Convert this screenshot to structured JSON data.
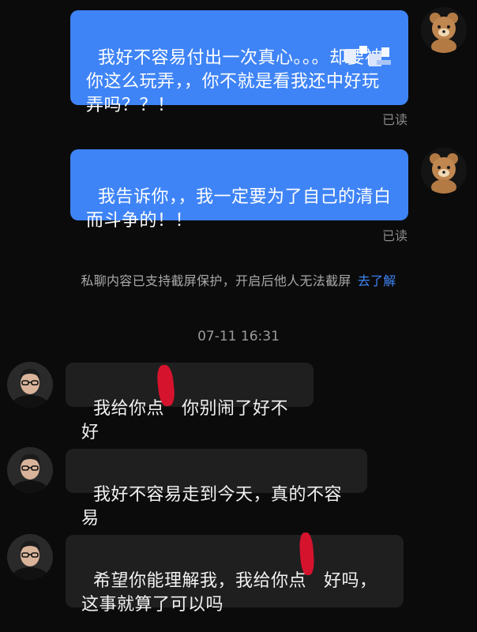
{
  "messages_mine": [
    {
      "text": "我好不容易付出一次真心。。。却要被你这么玩弄，，你不就是看我还",
      "text_tail": "中好玩弄吗？？！",
      "status": "已读"
    },
    {
      "text": "我告诉你，，我一定要为了自己的清白而斗争的！！",
      "status": "已读"
    }
  ],
  "system_notice": {
    "text": "私聊内容已支持截屏保护，开启后他人无法截屏",
    "link": "去了解"
  },
  "timestamp": "07-11 16:31",
  "messages_theirs": [
    {
      "text_before": "我给你点",
      "text_after": "你别闹了好不好"
    },
    {
      "text": "我好不容易走到今天，真的不容易"
    },
    {
      "text_before": "希望你能理解我，我给你点",
      "text_after": "好吗，这事就算了可以吗"
    }
  ],
  "icons": {
    "self_avatar": "teddy-bear-avatar-icon",
    "other_avatar": "man-with-glasses-avatar-icon"
  },
  "colors": {
    "mine_bubble": "#3f84f6",
    "theirs_bubble": "#1f1f1f",
    "background": "#0b0b0b",
    "link": "#3f84f6",
    "redaction": "#e0132e"
  }
}
